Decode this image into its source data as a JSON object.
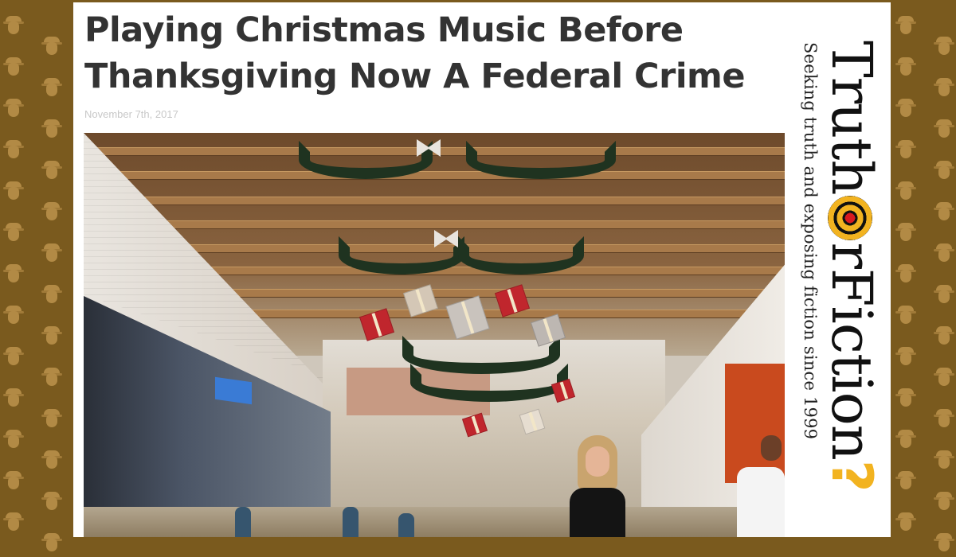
{
  "article": {
    "headline": "Playing Christmas Music Before Thanksgiving Now A Federal Crime",
    "date": "November 7th, 2017"
  },
  "logo": {
    "word_part1": "Truth",
    "word_part2": "rFiction",
    "question_mark": "?",
    "tagline": "Seeking truth and exposing fiction since 1999",
    "colors": {
      "accent": "#f2b320",
      "bullseye": "#d71920",
      "text": "#111111"
    }
  },
  "background": {
    "color": "#7a5a1e",
    "motif_color": "#b28a45"
  },
  "photo": {
    "icon": "mall-christmas-decorations-photo"
  }
}
